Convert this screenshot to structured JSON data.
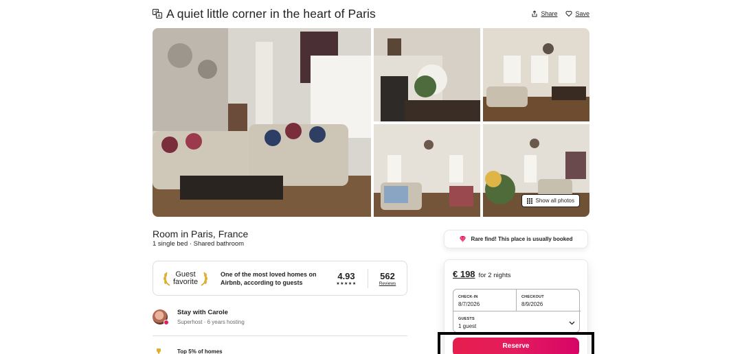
{
  "header": {
    "title": "A quiet little corner in the heart of Paris",
    "share_label": "Share",
    "save_label": "Save",
    "translate_icon": "translate-icon",
    "share_icon": "share-icon",
    "save_icon": "heart-icon"
  },
  "gallery": {
    "show_all_label": "Show all photos",
    "show_all_icon": "grid-icon"
  },
  "listing": {
    "room_title": "Room in Paris, France",
    "room_subtitle": "1 single bed · Shared bathroom"
  },
  "guest_favorite": {
    "badge_line1": "Guest",
    "badge_line2": "favorite",
    "description": "One of the most loved homes on Airbnb, according to guests",
    "rating": "4.93",
    "stars": "★★★★★",
    "reviews_count": "562",
    "reviews_label": "Reviews"
  },
  "host": {
    "name": "Stay with Carole",
    "meta": "Superhost · 6 years hosting"
  },
  "highlights": {
    "top_label": "Top 5% of homes"
  },
  "rare_find": {
    "text": "Rare find! This place is usually booked",
    "icon": "diamond-icon"
  },
  "booking": {
    "price": "€ 198",
    "price_for": "for 2 nights",
    "checkin_label": "CHECK-IN",
    "checkin_value": "8/7/2026",
    "checkout_label": "CHECKOUT",
    "checkout_value": "8/9/2026",
    "guests_label": "GUESTS",
    "guests_value": "1 guest",
    "reserve_label": "Reserve"
  },
  "colors": {
    "brand": "#e31c5f",
    "text": "#222222",
    "muted": "#6a6a6a",
    "border": "#dddddd"
  }
}
